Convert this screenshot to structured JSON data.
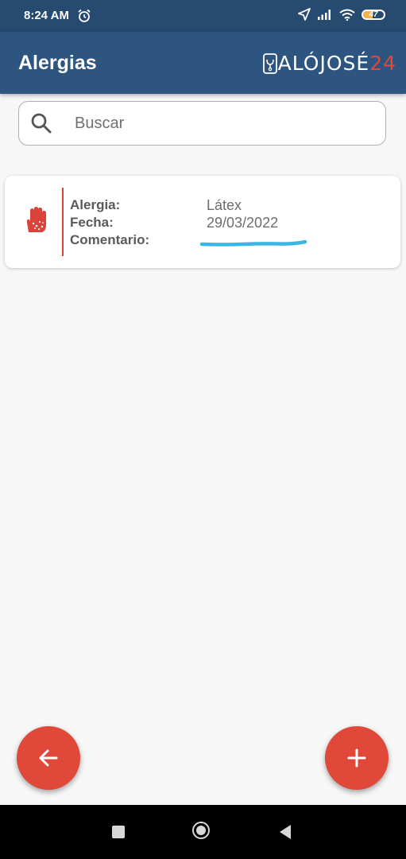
{
  "status_bar": {
    "time": "8:24 AM",
    "battery_level": "47",
    "icons": [
      "alarm-icon",
      "location-icon",
      "signal-icon",
      "wifi-icon",
      "battery-icon"
    ]
  },
  "app_bar": {
    "title": "Alergias",
    "logo_text": "ALÓJOSÉ",
    "logo_number": "24"
  },
  "search": {
    "placeholder": "Buscar",
    "value": ""
  },
  "allergies": [
    {
      "icon": "allergy-hand-icon",
      "labels": {
        "allergy": "Alergia:",
        "date": "Fecha:",
        "comment": "Comentario:"
      },
      "values": {
        "allergy": "Látex",
        "date": "29/03/2022",
        "comment": ""
      }
    }
  ],
  "fabs": {
    "back_icon": "arrow-back-icon",
    "add_icon": "plus-icon"
  },
  "colors": {
    "status_bar": "#264a70",
    "app_bar": "#2e5580",
    "accent": "#e0483a",
    "redaction": "#3cb6e3"
  }
}
